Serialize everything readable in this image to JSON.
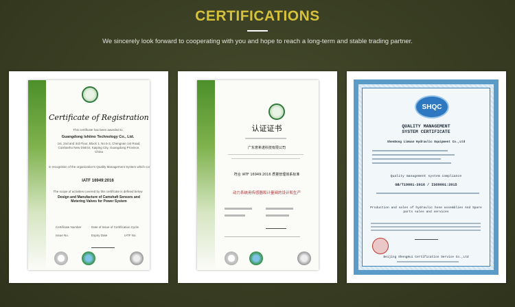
{
  "header": {
    "title": "CERTIFICATIONS",
    "subtitle": "We sincerely look forward to cooperating with you and hope to reach a long-term and stable trading partner."
  },
  "certificates": [
    {
      "heading": "Certificate of Registration",
      "awarded_text": "This certificate has been awarded to",
      "company": "Guangdong Ishiino Technology Co., Ltd.",
      "address": "1st, 2nd and 3rd Floor, Block 1, No.5-3, Chengnan 1st Road, Cuishanhu New District, Kaiping City, Guangdong Province, China",
      "recognition": "in recognition of the organization's Quality Management System which complies with",
      "standard": "IATF 16949:2016",
      "scope_intro": "The scope of activities covered by this certificate is defined below",
      "scope": "Design and Manufacture of Camshaft Sensors and Metering Valves for Power System",
      "footer_labels": [
        "Certificate Number",
        "Date of Issue of Certification Cycle",
        "Issue No.",
        "Expiry Date",
        "IATF No."
      ]
    },
    {
      "heading": "认证证书",
      "company": "广东意希诺科技有限公司",
      "standard_line": "符合 IATF 16949:2016 质量管理体系标准",
      "scope": "动力系统用传感器和计量阀的设计和生产"
    },
    {
      "logo_text": "SHQC",
      "heading_line1": "QUALITY MANAGEMENT",
      "heading_line2": "SYSTEM CERTIFICATE",
      "company": "ShenDong LiWuan Hydraulic Equipment Co.,Ltd",
      "compliance": "Quality management system compliance",
      "standard": "GB/T19001-2016 / ISO9001:2015",
      "scope": "Production and sales of hydraulic hose assemblies And Spare parts sales and services",
      "issuer": "Beijing ShengHui Certification Service Co.,Ltd"
    }
  ]
}
